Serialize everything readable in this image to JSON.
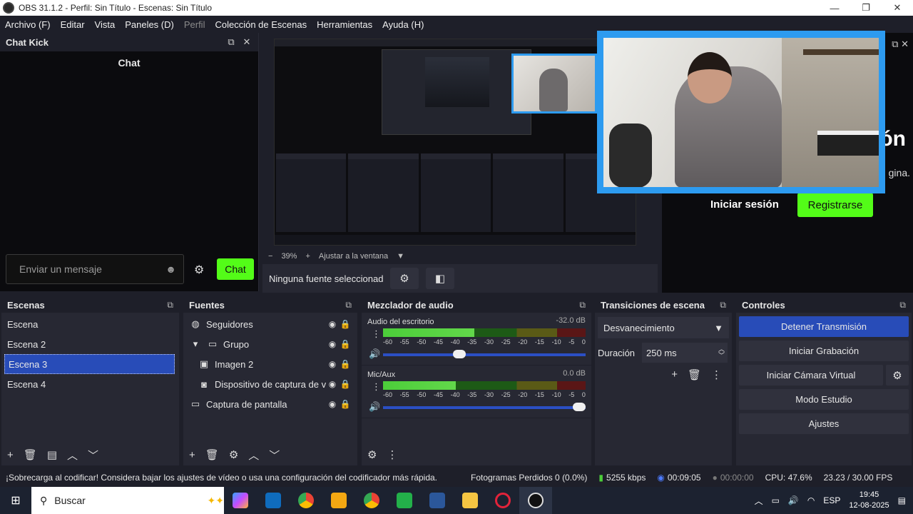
{
  "window": {
    "title": "OBS 31.1.2 - Perfil: Sin Título - Escenas: Sin Título",
    "minimize": "—",
    "restore": "❐",
    "close": "✕"
  },
  "menu": [
    "Archivo (F)",
    "Editar",
    "Vista",
    "Paneles (D)",
    "Perfil",
    "Colección de Escenas",
    "Herramientas",
    "Ayuda (H)"
  ],
  "chat_dock": {
    "title": "Chat Kick",
    "chat_heading": "Chat",
    "input_placeholder": "Enviar un mensaje",
    "send_label": "Chat"
  },
  "preview": {
    "zoom": "39%",
    "fit_label": "Ajustar a la ventana",
    "no_source": "Ninguna fuente seleccionada",
    "minus": "−",
    "plus": "+"
  },
  "kick_page": {
    "heading_fragment": "ón",
    "sub_fragment": "gina.",
    "login": "Iniciar sesión",
    "register": "Registrarse"
  },
  "scenes": {
    "title": "Escenas",
    "items": [
      "Escena",
      "Escena 2",
      "Escena 3",
      "Escena 4"
    ],
    "selected_index": 2
  },
  "sources": {
    "title": "Fuentes",
    "items": [
      {
        "name": "Seguidores",
        "icon": "globe-icon",
        "indent": 0
      },
      {
        "name": "Grupo",
        "icon": "folder-icon",
        "indent": 0
      },
      {
        "name": "Imagen 2",
        "icon": "image-icon",
        "indent": 1
      },
      {
        "name": "Dispositivo de captura de vídeo",
        "icon": "camera-icon",
        "indent": 1
      },
      {
        "name": "Captura de pantalla",
        "icon": "monitor-icon",
        "indent": 0
      }
    ]
  },
  "mixer": {
    "title": "Mezclador de audio",
    "tracks": [
      {
        "name": "Audio del escritorio",
        "db": "-32.0 dB",
        "level": 0.45,
        "volume": 0.37
      },
      {
        "name": "Mic/Aux",
        "db": "0.0 dB",
        "level": 0.36,
        "volume": 1.0
      }
    ],
    "scale": [
      "-60",
      "-55",
      "-50",
      "-45",
      "-40",
      "-35",
      "-30",
      "-25",
      "-20",
      "-15",
      "-10",
      "-5",
      "0"
    ]
  },
  "transitions": {
    "title": "Transiciones de escena",
    "selected": "Desvanecimiento",
    "duration_label": "Duración",
    "duration_value": "250 ms"
  },
  "controls": {
    "title": "Controles",
    "buttons": [
      "Detener Transmisión",
      "Iniciar Grabación",
      "Iniciar Cámara Virtual",
      "Modo Estudio",
      "Ajustes"
    ]
  },
  "status": {
    "warning": "¡Sobrecarga al codificar! Considera bajar los ajustes de vídeo o usa una configuración del codificador más rápida.",
    "dropped": "Fotogramas Perdidos 0 (0.0%)",
    "bitrate": "5255 kbps",
    "stream_time": "00:09:05",
    "rec_time": "00:00:00",
    "cpu": "CPU: 47.6%",
    "fps": "23.23 / 30.00 FPS"
  },
  "taskbar": {
    "search_placeholder": "Buscar",
    "lang": "ESP",
    "time": "19:45",
    "date": "12-08-2025"
  },
  "colors": {
    "accent_blue": "#284cb8",
    "kick_green": "#53fc18",
    "webcam_border": "#2d9bf0"
  }
}
